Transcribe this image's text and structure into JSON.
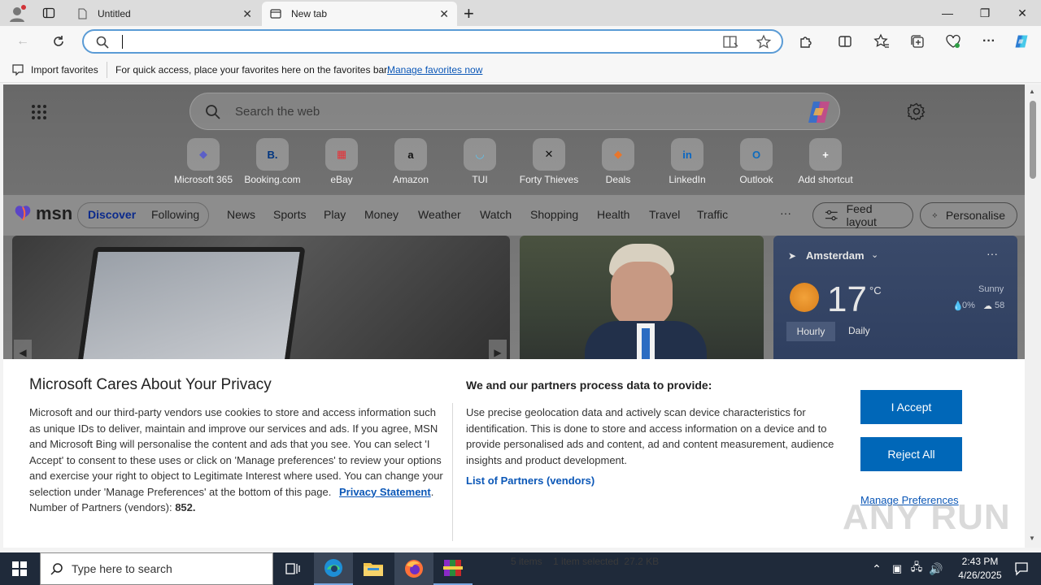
{
  "browser": {
    "tabs": [
      {
        "title": "Untitled",
        "active": false
      },
      {
        "title": "New tab",
        "active": true
      }
    ],
    "new_tab_symbol": "+",
    "window_controls": [
      "—",
      "❐",
      "✕"
    ],
    "address_value": ""
  },
  "favorites_bar": {
    "import_label": "Import favorites",
    "hint": "For quick access, place your favorites here on the favorites bar.",
    "manage_link": "Manage favorites now"
  },
  "newtab": {
    "search_placeholder": "Search the web",
    "shortcuts": [
      {
        "label": "Microsoft 365",
        "glyph": "◆",
        "color": "#5b5fc7"
      },
      {
        "label": "Booking.com",
        "glyph": "B.",
        "color": "#003580"
      },
      {
        "label": "eBay",
        "glyph": "▦",
        "color": "#e53238"
      },
      {
        "label": "Amazon",
        "glyph": "a",
        "color": "#111111"
      },
      {
        "label": "TUI",
        "glyph": "◡",
        "color": "#5ec3f0"
      },
      {
        "label": "Forty Thieves",
        "glyph": "✕",
        "color": "#111111"
      },
      {
        "label": "Deals",
        "glyph": "◆",
        "color": "#e8762b"
      },
      {
        "label": "LinkedIn",
        "glyph": "in",
        "color": "#0a66c2"
      },
      {
        "label": "Outlook",
        "glyph": "O",
        "color": "#0f6cbd"
      },
      {
        "label": "Add shortcut",
        "glyph": "+",
        "color": "#ffffff"
      }
    ]
  },
  "msn": {
    "logo": "msn",
    "toggle": [
      "Discover",
      "Following"
    ],
    "categories": [
      "News",
      "Sports",
      "Play",
      "Money",
      "Weather",
      "Watch",
      "Shopping",
      "Health",
      "Travel",
      "Traffic"
    ],
    "more": "···",
    "feed_layout": "Feed layout",
    "personalise": "Personalise"
  },
  "weather": {
    "city": "Amsterdam",
    "temp": "17",
    "unit": "°C",
    "condition": "Sunny",
    "precip": "0%",
    "aqi": "58",
    "tabs": [
      "Hourly",
      "Daily"
    ]
  },
  "consent": {
    "title": "Microsoft Cares About Your Privacy",
    "body": "Microsoft and our third-party vendors use cookies to store and access information such as unique IDs to deliver, maintain and improve our services and ads. If you agree, MSN and Microsoft Bing will personalise the content and ads that you see. You can select 'I Accept' to consent to these uses or click on 'Manage preferences' to review your options and exercise your right to object to Legitimate Interest where used.  You can change your selection under 'Manage Preferences' at the bottom of this page.",
    "privacy_link": "Privacy Statement",
    "partners_label": "Number of Partners (vendors):",
    "partners_count": "852.",
    "right_title": "We and our partners process data to provide:",
    "right_body": "Use precise geolocation data and actively scan device characteristics for identification. This is done to store and access information on a device and to provide personalised ads and content, ad and content measurement, audience insights and product development.",
    "partners_list_link": "List of Partners (vendors)",
    "accept": "I Accept",
    "reject": "Reject All",
    "manage": "Manage Preferences"
  },
  "taskbar": {
    "search_placeholder": "Type here to search",
    "explorer_status": "5 items    1 item selected  27.2 KB",
    "time": "2:43 PM",
    "date": "4/26/2025"
  },
  "watermark": "ANY RUN"
}
